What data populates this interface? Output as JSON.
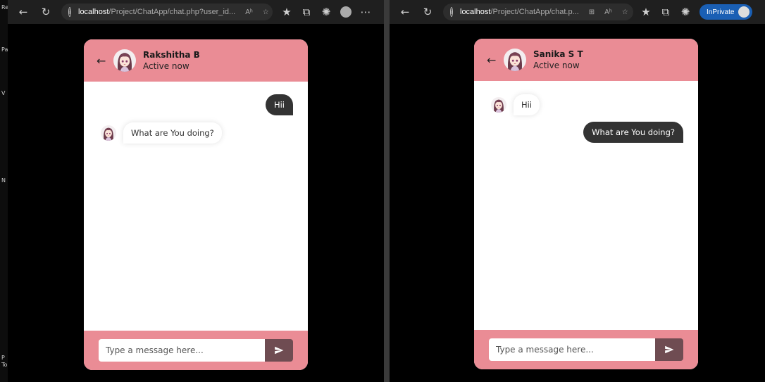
{
  "browser_left": {
    "url_host": "localhost",
    "url_path": "/Project/ChatApp/chat.php?user_id...",
    "read_aloud": "Aʰ"
  },
  "browser_right": {
    "url_host": "localhost",
    "url_path": "/Project/ChatApp/chat.p...",
    "read_aloud": "Aʰ",
    "inprivate_label": "InPrivate"
  },
  "left_strip": [
    "Re",
    "Pa",
    "V",
    "N",
    "P",
    "To"
  ],
  "chat_left": {
    "name": "Rakshitha B",
    "status": "Active now",
    "messages": [
      {
        "direction": "outgoing",
        "text": "Hii"
      },
      {
        "direction": "incoming",
        "text": "What are You doing?"
      }
    ],
    "input_placeholder": "Type a message here..."
  },
  "chat_right": {
    "name": "Sanika S T",
    "status": "Active now",
    "messages": [
      {
        "direction": "incoming",
        "text": "Hii"
      },
      {
        "direction": "outgoing",
        "text": "What are You doing?"
      }
    ],
    "input_placeholder": "Type a message here..."
  },
  "colors": {
    "header_pink": "#ea8c95",
    "send_button": "#6f4c52",
    "outgoing_bubble": "#333333"
  }
}
